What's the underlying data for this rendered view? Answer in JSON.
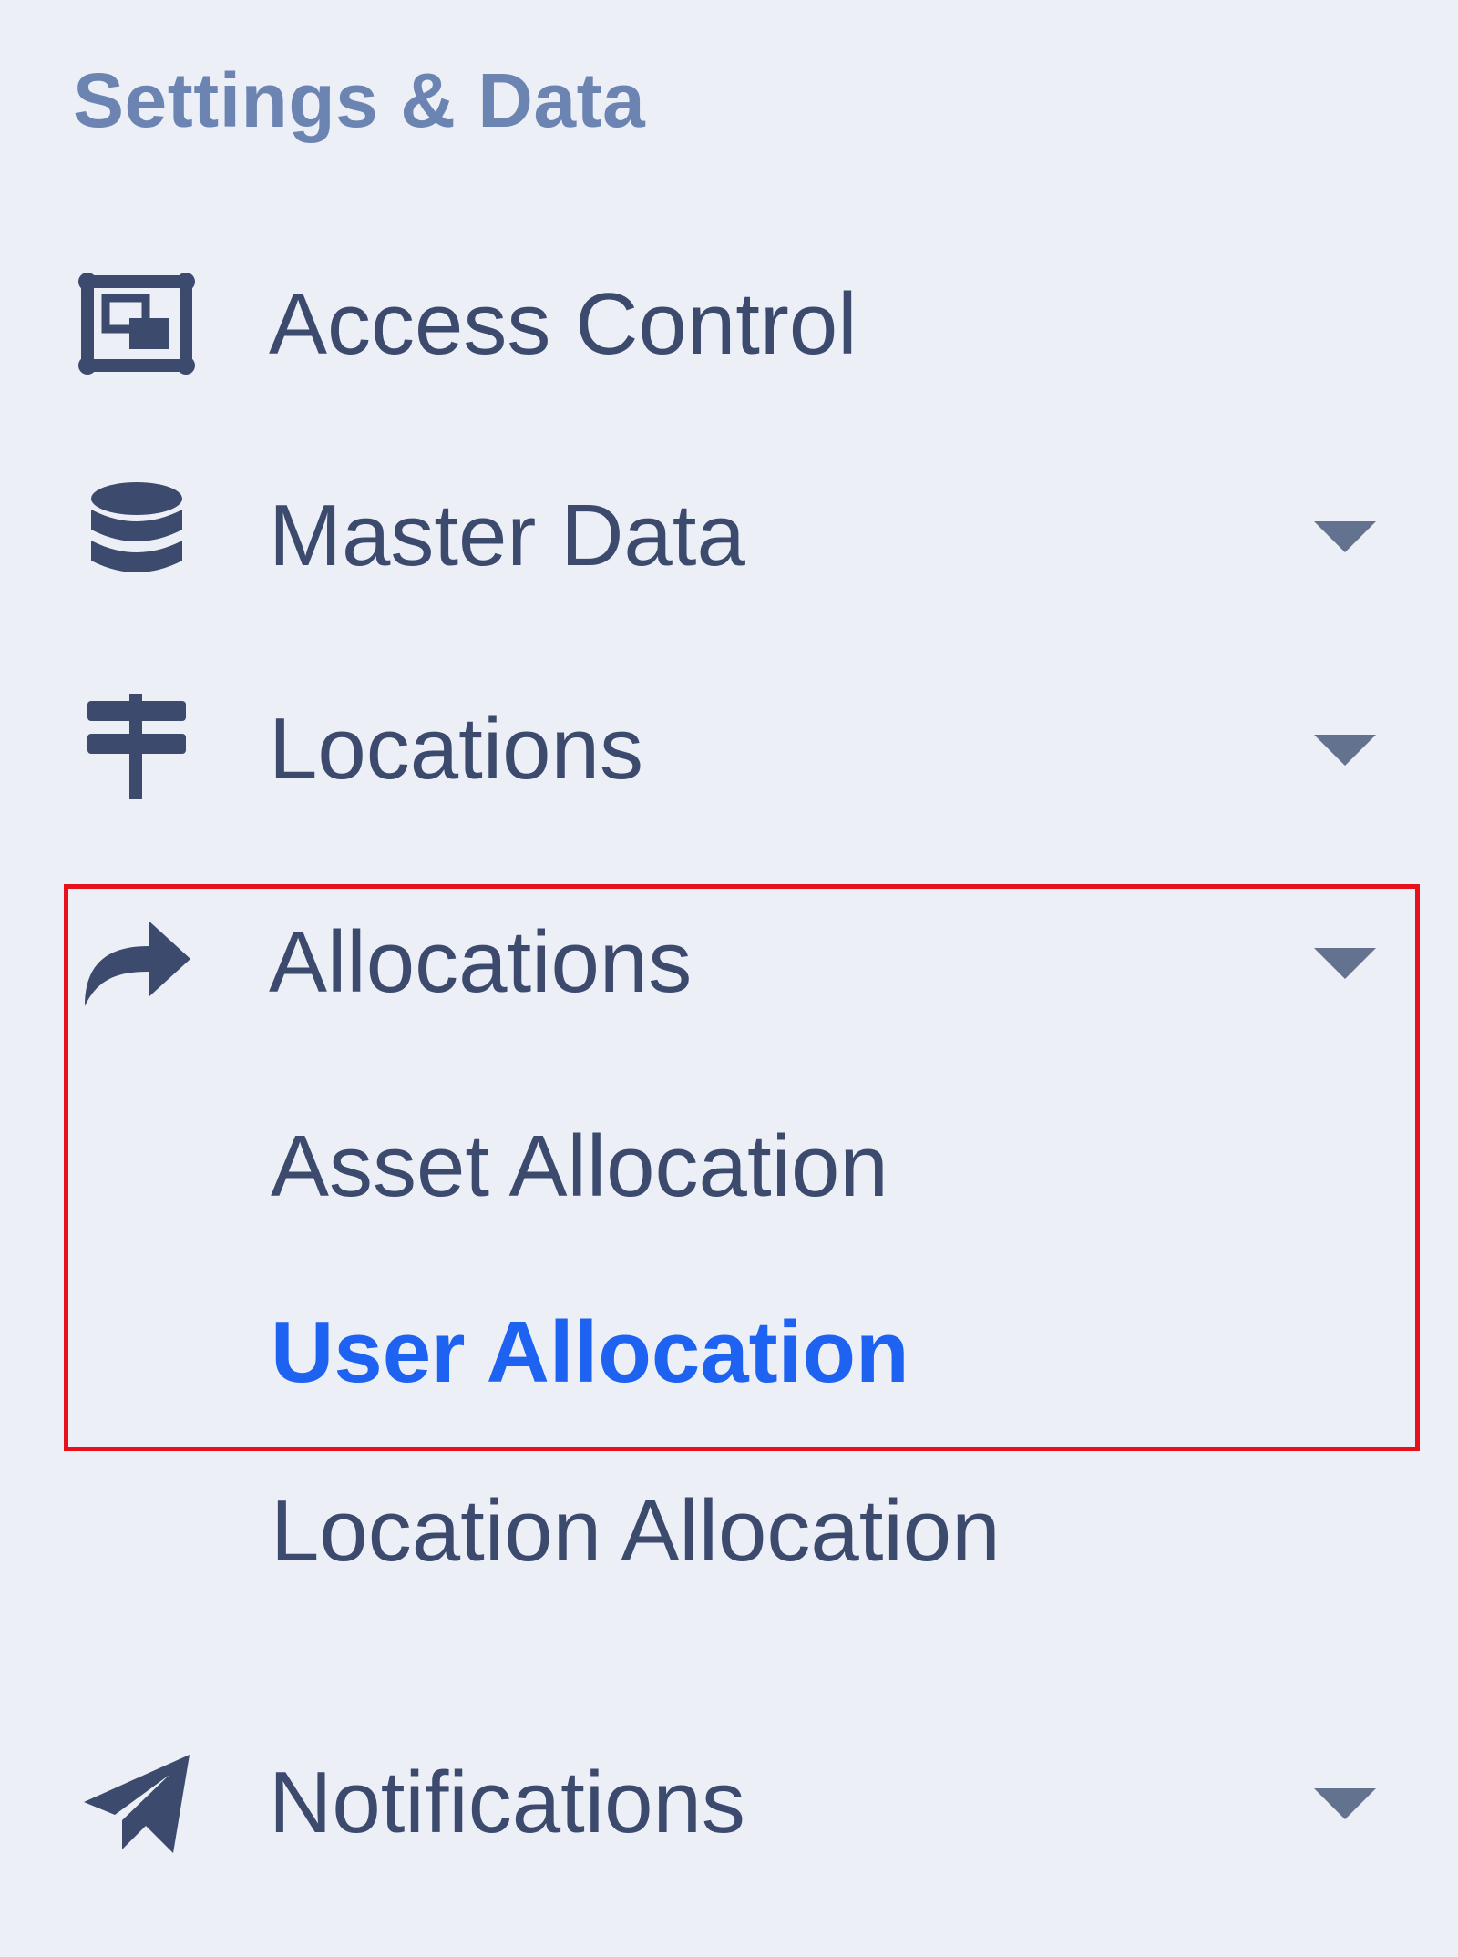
{
  "sidebar": {
    "section_title": "Settings & Data",
    "items": [
      {
        "label": "Access Control",
        "icon": "access-control-icon",
        "has_caret": false
      },
      {
        "label": "Master Data",
        "icon": "database-icon",
        "has_caret": true
      },
      {
        "label": "Locations",
        "icon": "signpost-icon",
        "has_caret": true
      },
      {
        "label": "Allocations",
        "icon": "share-arrow-icon",
        "has_caret": true,
        "expanded": true,
        "children": [
          {
            "label": "Asset Allocation",
            "active": false
          },
          {
            "label": "User Allocation",
            "active": true
          },
          {
            "label": "Location Allocation",
            "active": false
          }
        ]
      },
      {
        "label": "Notifications",
        "icon": "paper-plane-icon",
        "has_caret": true
      }
    ]
  },
  "colors": {
    "background": "#eceff6",
    "text": "#3b4a6d",
    "section_title": "#6c84b2",
    "active": "#1e62f2",
    "highlight_border": "#e6111c",
    "icon": "#3b4a6d",
    "caret": "#63738f"
  }
}
